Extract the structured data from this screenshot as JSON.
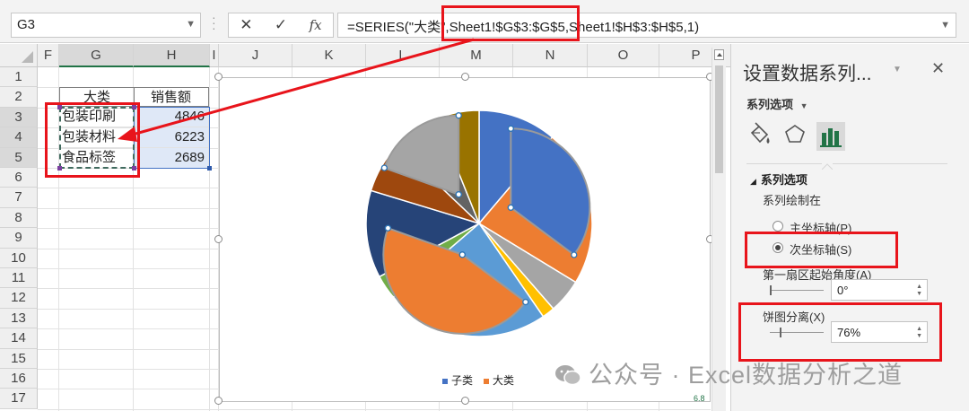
{
  "formula_bar": {
    "name_box": "G3",
    "cancel_glyph": "✕",
    "enter_glyph": "✓",
    "fx_glyph": "fx",
    "formula": "=SERIES(\"大类\",Sheet1!$G$3:$G$5,Sheet1!$H$3:$H$5,1)"
  },
  "columns": [
    "F",
    "G",
    "H",
    "I",
    "J",
    "K",
    "L",
    "M",
    "N",
    "O",
    "P"
  ],
  "rows": [
    "1",
    "2",
    "3",
    "4",
    "5",
    "6",
    "7",
    "8",
    "9",
    "10",
    "11",
    "12",
    "13",
    "14",
    "15",
    "16",
    "17"
  ],
  "table": {
    "headers": [
      "大类",
      "销售额"
    ],
    "rows": [
      {
        "category": "包装印刷",
        "sales": "4846"
      },
      {
        "category": "包装材料",
        "sales": "6223"
      },
      {
        "category": "食品标签",
        "sales": "2689"
      }
    ]
  },
  "chart_data": {
    "type": "pie",
    "legend": [
      "子类",
      "大类"
    ],
    "legend_position": "bottom",
    "outer_series": {
      "name": "子类",
      "slices": [
        {
          "color": "#4472c4",
          "value": 11.2
        },
        {
          "color": "#ed7d31",
          "value": 22.5
        },
        {
          "color": "#a5a5a5",
          "value": 4.9
        },
        {
          "color": "#ffc000",
          "value": 1.8
        },
        {
          "color": "#5b9bd5",
          "value": 23.3
        },
        {
          "color": "#70ad47",
          "value": 3.5
        },
        {
          "color": "#264478",
          "value": 12.5
        },
        {
          "color": "#9e480e",
          "value": 7.4
        },
        {
          "color": "#636363",
          "value": 6.8
        },
        {
          "color": "#997300",
          "value": 6.1
        }
      ]
    },
    "inner_series": {
      "name": "大类",
      "explosion_percent": 76,
      "slices": [
        {
          "label": "包装印刷",
          "value": 4846,
          "color": "#4472c4"
        },
        {
          "label": "包装材料",
          "value": 6223,
          "color": "#ed7d31"
        },
        {
          "label": "食品标签",
          "value": 2689,
          "color": "#a5a5a5"
        }
      ]
    },
    "corner_text": "6.8"
  },
  "pane": {
    "title": "设置数据系列...",
    "dropdown_glyph": "▼",
    "close_glyph": "✕",
    "series_options_menu": "系列选项",
    "section_title": "系列选项",
    "plot_on_label": "系列绘制在",
    "primary_axis": "主坐标轴(P)",
    "secondary_axis": "次坐标轴(S)",
    "secondary_selected": true,
    "first_slice_angle_label": "第一扇区起始角度(A)",
    "first_slice_angle_value": "0°",
    "explosion_label": "饼图分离(X)",
    "explosion_value": "76%",
    "explosion_level": 0.76
  },
  "watermark": "公众号 · Excel数据分析之道",
  "colors": {
    "accent_red": "#e8141b",
    "excel_green": "#217346"
  }
}
